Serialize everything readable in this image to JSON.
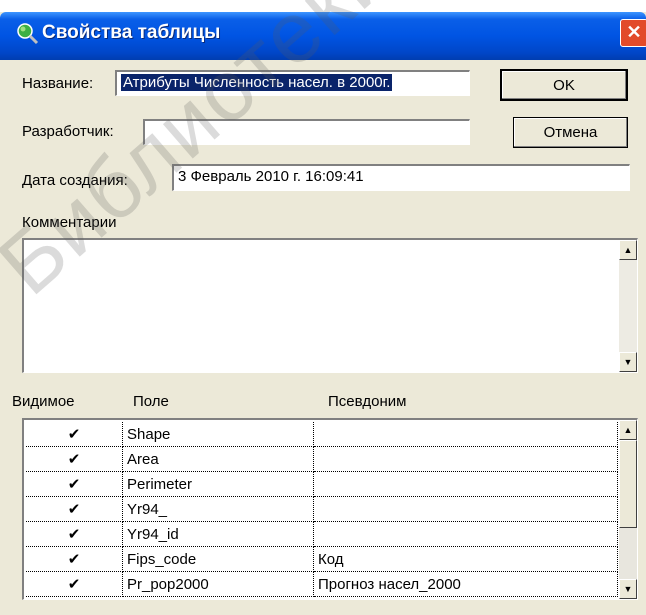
{
  "window": {
    "title": "Свойства таблицы",
    "close_glyph": "✕"
  },
  "form": {
    "name_label": "Название:",
    "name_value": "Атрибуты Численность насел. в 2000г.",
    "developer_label": "Разработчик:",
    "developer_value": "",
    "created_label": "Дата создания:",
    "created_value": "3 Февраль 2010 г. 16:09:41",
    "comments_label": "Комментарии",
    "comments_value": ""
  },
  "buttons": {
    "ok": "OK",
    "cancel": "Отмена"
  },
  "scroll_glyphs": {
    "up": "▲",
    "down": "▼"
  },
  "grid": {
    "headers": {
      "visible": "Видимое",
      "field": "Поле",
      "alias": "Псевдоним"
    },
    "rows": [
      {
        "check": "✔",
        "field": "Shape",
        "alias": ""
      },
      {
        "check": "✔",
        "field": "Area",
        "alias": ""
      },
      {
        "check": "✔",
        "field": "Perimeter",
        "alias": ""
      },
      {
        "check": "✔",
        "field": "Yr94_",
        "alias": ""
      },
      {
        "check": "✔",
        "field": "Yr94_id",
        "alias": ""
      },
      {
        "check": "✔",
        "field": "Fips_code",
        "alias": "Код"
      },
      {
        "check": "✔",
        "field": "Pr_pop2000",
        "alias": "Прогноз насел_2000"
      }
    ]
  },
  "watermark": "Библиотеки МГУ имени"
}
